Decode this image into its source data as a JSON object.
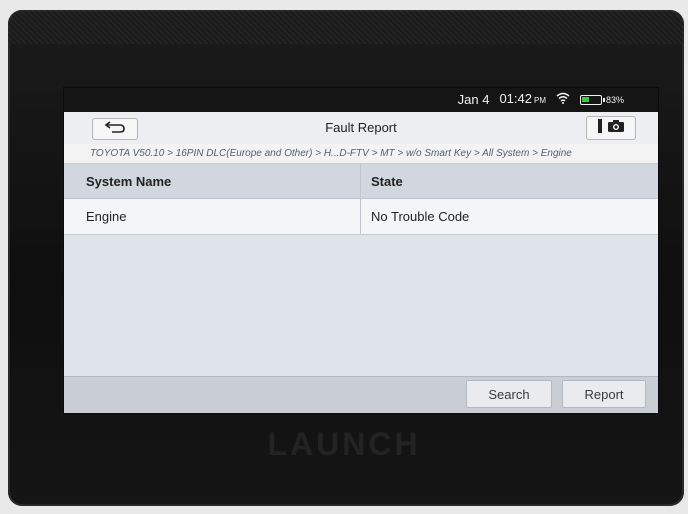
{
  "status": {
    "date": "Jan 4",
    "time": "01:42",
    "ampm": "PM",
    "battery": "83%"
  },
  "header": {
    "title": "Fault Report"
  },
  "breadcrumb": "TOYOTA V50.10 > 16PIN DLC(Europe and Other) > H...D-FTV > MT > w/o Smart Key > All System > Engine",
  "table": {
    "columns": [
      "System Name",
      "State"
    ],
    "rows": [
      [
        "Engine",
        "No Trouble Code"
      ]
    ]
  },
  "buttons": {
    "search": "Search",
    "report": "Report"
  },
  "device": {
    "brand": "LAUNCH"
  },
  "colors": {
    "battery": "#3fc64a",
    "header_row": "#d2d6de",
    "breadcrumb_text": "#4f6275"
  },
  "icons": [
    "back-arrow-icon",
    "wifi-icon",
    "battery-icon",
    "screenshot-icon",
    "camera-icon"
  ]
}
